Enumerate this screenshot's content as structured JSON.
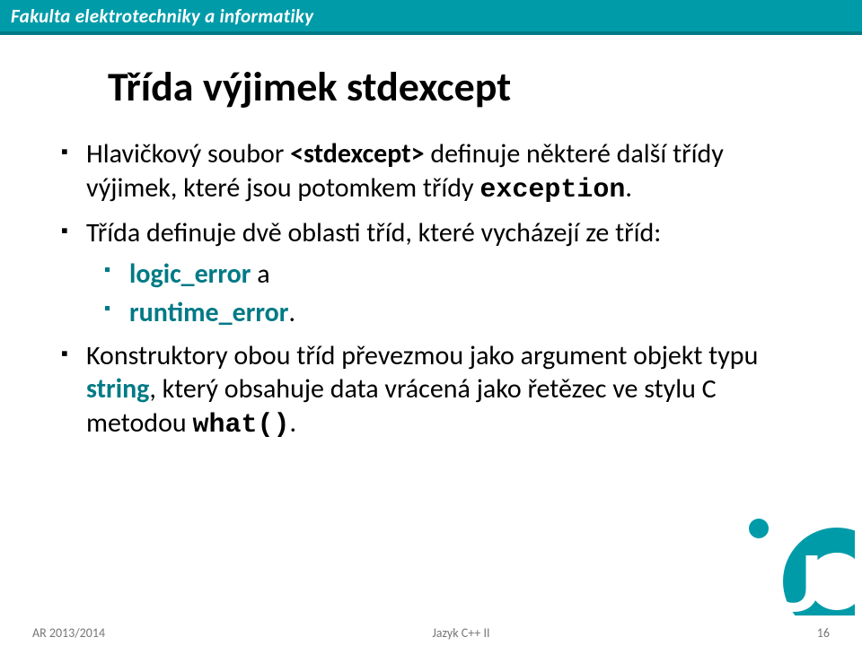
{
  "header": {
    "faculty": "Fakulta elektrotechniky a informatiky"
  },
  "title": "Třída výjimek stdexcept",
  "bullets": {
    "b1_pre": "Hlavičkový soubor ",
    "b1_tag": "<stdexcept>",
    "b1_mid": " definuje některé další třídy výjimek, které jsou potomkem třídy ",
    "b1_code": "exception",
    "b1_end": ".",
    "b2": "Třída definuje dvě oblasti tříd, které vycházejí ze tříd:",
    "sub1_bold": "logic_error",
    "sub1_rest": " a",
    "sub2_bold": "runtime_error",
    "sub2_rest": ".",
    "b3_pre": "Konstruktory obou tříd převezmou jako argument objekt typu ",
    "b3_bold": "string",
    "b3_mid": ", který obsahuje data vrácená jako řetězec ve stylu  C metodou ",
    "b3_code": "what()",
    "b3_end": "."
  },
  "logo_letter": "U",
  "footer": {
    "left": "AR 2013/2014",
    "center": "Jazyk C++ II",
    "page": "16"
  }
}
